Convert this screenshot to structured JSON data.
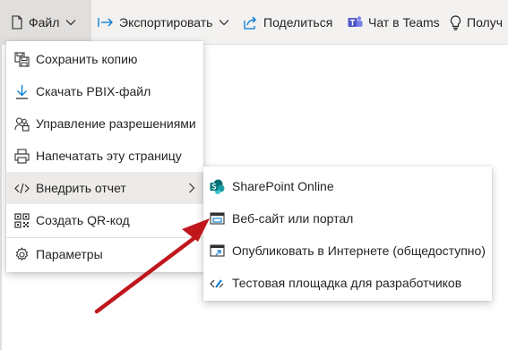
{
  "toolbar": {
    "file": "Файл",
    "export": "Экспортировать",
    "share": "Поделиться",
    "teams": "Чат в Teams",
    "insights": "Получ"
  },
  "file_menu": {
    "items": [
      {
        "label": "Сохранить копию",
        "icon": "save-copy-icon"
      },
      {
        "label": "Скачать PBIX-файл",
        "icon": "download-icon"
      },
      {
        "label": "Управление разрешениями",
        "icon": "permissions-icon"
      },
      {
        "label": "Напечатать эту страницу",
        "icon": "print-icon"
      },
      {
        "label": "Внедрить отчет",
        "icon": "embed-code-icon"
      },
      {
        "label": "Создать QR-код",
        "icon": "qr-code-icon"
      },
      {
        "label": "Параметры",
        "icon": "settings-gear-icon"
      }
    ]
  },
  "embed_submenu": {
    "items": [
      {
        "label": "SharePoint Online",
        "icon": "sharepoint-icon"
      },
      {
        "label": "Веб-сайт или портал",
        "icon": "website-icon"
      },
      {
        "label": "Опубликовать в Интернете (общедоступно)",
        "icon": "publish-web-icon"
      },
      {
        "label": "Тестовая площадка для разработчиков",
        "icon": "developer-playground-icon"
      }
    ]
  },
  "colors": {
    "accent": "#0078d4",
    "annotation_arrow": "#c0171d",
    "sharepoint": "#038387",
    "teams": "#5059c9"
  }
}
